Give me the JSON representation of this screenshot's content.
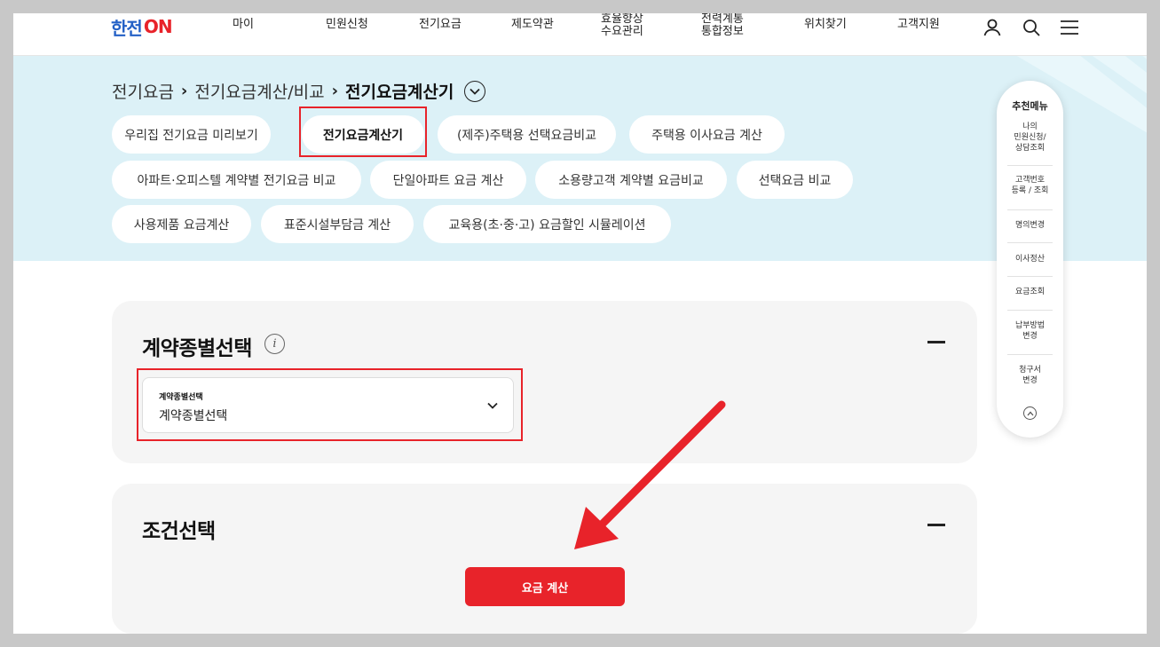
{
  "header": {
    "logo_main": "한전",
    "logo_on": "ON",
    "nav": [
      "마이",
      "민원신청",
      "전기요금",
      "제도약관",
      "효율향상\n수요관리",
      "전력계통\n통합정보",
      "위치찾기",
      "고객지원"
    ],
    "icons": [
      "user-icon",
      "search-icon",
      "menu-icon"
    ]
  },
  "breadcrumb": {
    "level1": "전기요금",
    "level2": "전기요금계산/비교",
    "current": "전기요금계산기"
  },
  "chips": [
    "우리집 전기요금 미리보기",
    "전기요금계산기",
    "(제주)주택용 선택요금비교",
    "주택용 이사요금 계산",
    "아파트·오피스텔 계약별 전기요금 비교",
    "단일아파트 요금 계산",
    "소용량고객 계약별 요금비교",
    "선택요금 비교",
    "사용제품 요금계산",
    "표준시설부담금 계산",
    "교육용(초·중·고) 요금할인 시뮬레이션"
  ],
  "active_chip_index": 1,
  "side_menu": {
    "title": "추천메뉴",
    "items": [
      "나의\n민원신청/\n상담조회",
      "고객번호\n등록 / 조회",
      "명의변경",
      "이사정산",
      "요금조회",
      "납부방법\n변경",
      "청구서\n변경"
    ]
  },
  "contract_panel": {
    "title": "계약종별선택",
    "select_label": "계약종별선택",
    "select_value": "계약종별선택"
  },
  "condition_panel": {
    "title": "조건선택",
    "calc_button": "요금 계산"
  },
  "colors": {
    "accent_red": "#e8232a",
    "band_bg": "#dcf1f7",
    "logo_blue": "#2461c6"
  }
}
